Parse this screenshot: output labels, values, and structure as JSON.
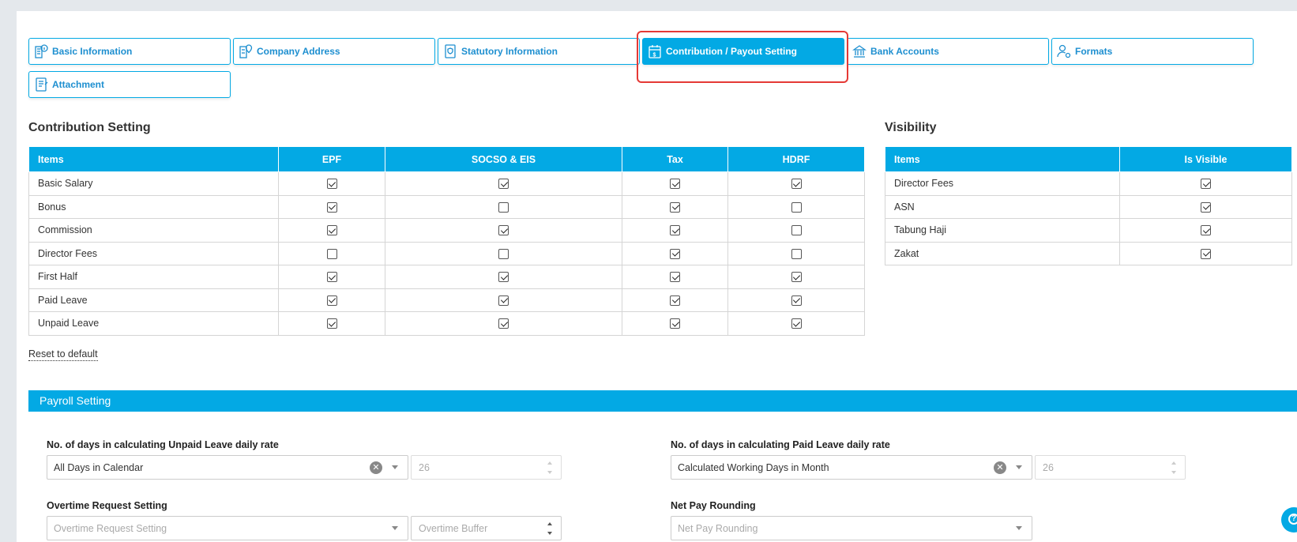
{
  "tabs": [
    {
      "label": "Basic Information",
      "icon": "building-info-icon",
      "active": false
    },
    {
      "label": "Company Address",
      "icon": "building-pin-icon",
      "active": false
    },
    {
      "label": "Statutory Information",
      "icon": "document-shield-icon",
      "active": false
    },
    {
      "label": "Contribution / Payout Setting",
      "icon": "calendar-money-icon",
      "active": true
    },
    {
      "label": "Bank Accounts",
      "icon": "bank-icon",
      "active": false
    },
    {
      "label": "Formats",
      "icon": "user-settings-icon",
      "active": false
    },
    {
      "label": "Attachment",
      "icon": "document-attach-icon",
      "active": false
    }
  ],
  "contribution": {
    "title": "Contribution Setting",
    "columns": [
      "Items",
      "EPF",
      "SOCSO & EIS",
      "Tax",
      "HDRF"
    ],
    "rows": [
      {
        "item": "Basic Salary",
        "epf": true,
        "socso": true,
        "tax": true,
        "hdrf": true
      },
      {
        "item": "Bonus",
        "epf": true,
        "socso": false,
        "tax": true,
        "hdrf": false
      },
      {
        "item": "Commission",
        "epf": true,
        "socso": true,
        "tax": true,
        "hdrf": false
      },
      {
        "item": "Director Fees",
        "epf": false,
        "socso": false,
        "tax": true,
        "hdrf": false
      },
      {
        "item": "First Half",
        "epf": true,
        "socso": true,
        "tax": true,
        "hdrf": true
      },
      {
        "item": "Paid Leave",
        "epf": true,
        "socso": true,
        "tax": true,
        "hdrf": true
      },
      {
        "item": "Unpaid Leave",
        "epf": true,
        "socso": true,
        "tax": true,
        "hdrf": true
      }
    ],
    "reset_label": "Reset to default"
  },
  "visibility": {
    "title": "Visibility",
    "columns": [
      "Items",
      "Is Visible"
    ],
    "rows": [
      {
        "item": "Director Fees",
        "visible": true
      },
      {
        "item": "ASN",
        "visible": true
      },
      {
        "item": "Tabung Haji",
        "visible": true
      },
      {
        "item": "Zakat",
        "visible": true
      }
    ]
  },
  "payroll": {
    "title": "Payroll Setting",
    "unpaid_leave": {
      "label": "No. of days in calculating Unpaid Leave daily rate",
      "value": "All Days in Calendar",
      "days": "26"
    },
    "paid_leave": {
      "label": "No. of days in calculating Paid Leave daily rate",
      "value": "Calculated Working Days in Month",
      "days": "26"
    },
    "overtime": {
      "label": "Overtime Request Setting",
      "placeholder": "Overtime Request Setting",
      "buffer_placeholder": "Overtime Buffer"
    },
    "net_pay": {
      "label": "Net Pay Rounding",
      "placeholder": "Net Pay Rounding"
    }
  },
  "colors": {
    "accent": "#03a9e4",
    "highlight": "#e53935"
  }
}
